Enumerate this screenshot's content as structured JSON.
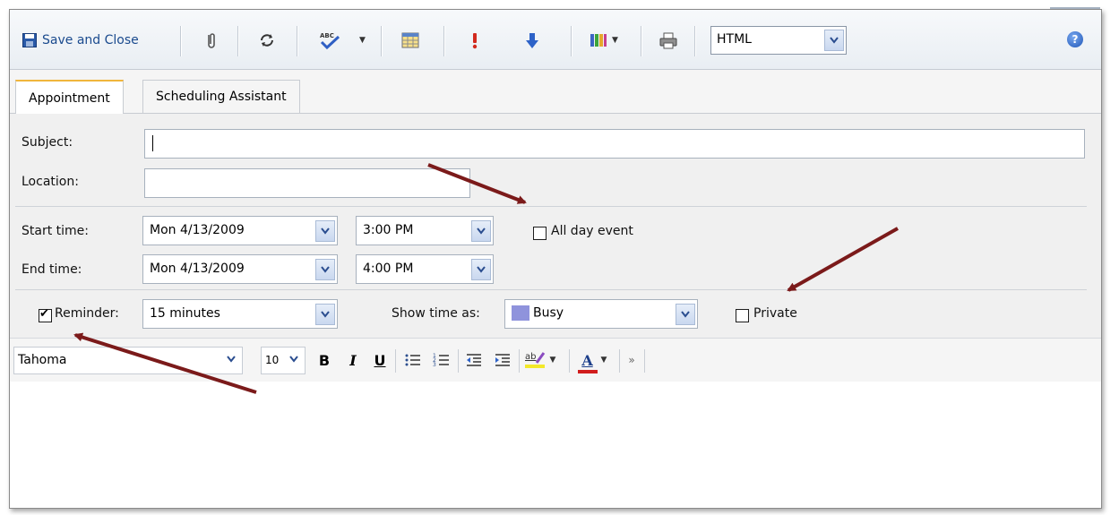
{
  "toolbar": {
    "save_label": "Save and Close",
    "format_value": "HTML",
    "help_icon": "?"
  },
  "tabs": [
    {
      "label": "Appointment",
      "active": true
    },
    {
      "label": "Scheduling Assistant",
      "active": false
    }
  ],
  "form": {
    "subject_label": "Subject:",
    "subject_value": "",
    "location_label": "Location:",
    "location_value": "",
    "start_label": "Start time:",
    "start_date": "Mon 4/13/2009",
    "start_time": "3:00 PM",
    "all_day_label": "All day event",
    "end_label": "End time:",
    "end_date": "Mon 4/13/2009",
    "end_time": "4:00 PM",
    "reminder_label": "Reminder:",
    "reminder_checked": true,
    "reminder_value": "15 minutes",
    "show_time_label": "Show time as:",
    "show_time_value": "Busy",
    "busy_color": "#8f93dc",
    "private_label": "Private"
  },
  "rte": {
    "font_value": "Tahoma",
    "size_value": "10",
    "bold": "B",
    "italic": "I",
    "underline": "U",
    "font_color_label": "A",
    "highlight_label": "ab"
  },
  "annotation_color": "#7b1a1a"
}
